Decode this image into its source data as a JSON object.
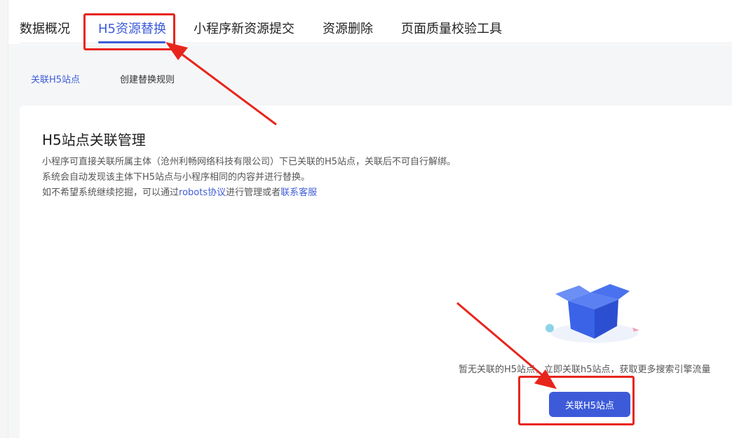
{
  "tabs": [
    {
      "label": "数据概况"
    },
    {
      "label": "H5资源替换"
    },
    {
      "label": "小程序新资源提交"
    },
    {
      "label": "资源删除"
    },
    {
      "label": "页面质量校验工具"
    }
  ],
  "subtabs": [
    {
      "label": "关联H5站点"
    },
    {
      "label": "创建替换规则"
    }
  ],
  "card": {
    "title": "H5站点关联管理",
    "desc_line1": "小程序可直接关联所属主体（沧州利畅网络科技有限公司）下已关联的H5站点，关联后不可自行解绑。",
    "desc_line2": "系统会自动发现该主体下H5站点与小程序相同的内容并进行替换。",
    "desc_line3_prefix": "如不希望系统继续挖掘，可以通过",
    "desc_line3_link1": "robots协议",
    "desc_line3_mid": "进行管理或者",
    "desc_line3_link2": "联系客服"
  },
  "empty_state": {
    "text": "暂无关联的H5站点，立即关联h5站点，获取更多搜索引擎流量",
    "button_label": "关联H5站点"
  },
  "colors": {
    "accent": "#3d5bd9",
    "annotation_red": "#e8251c",
    "background_gray": "#f5f6f8"
  }
}
